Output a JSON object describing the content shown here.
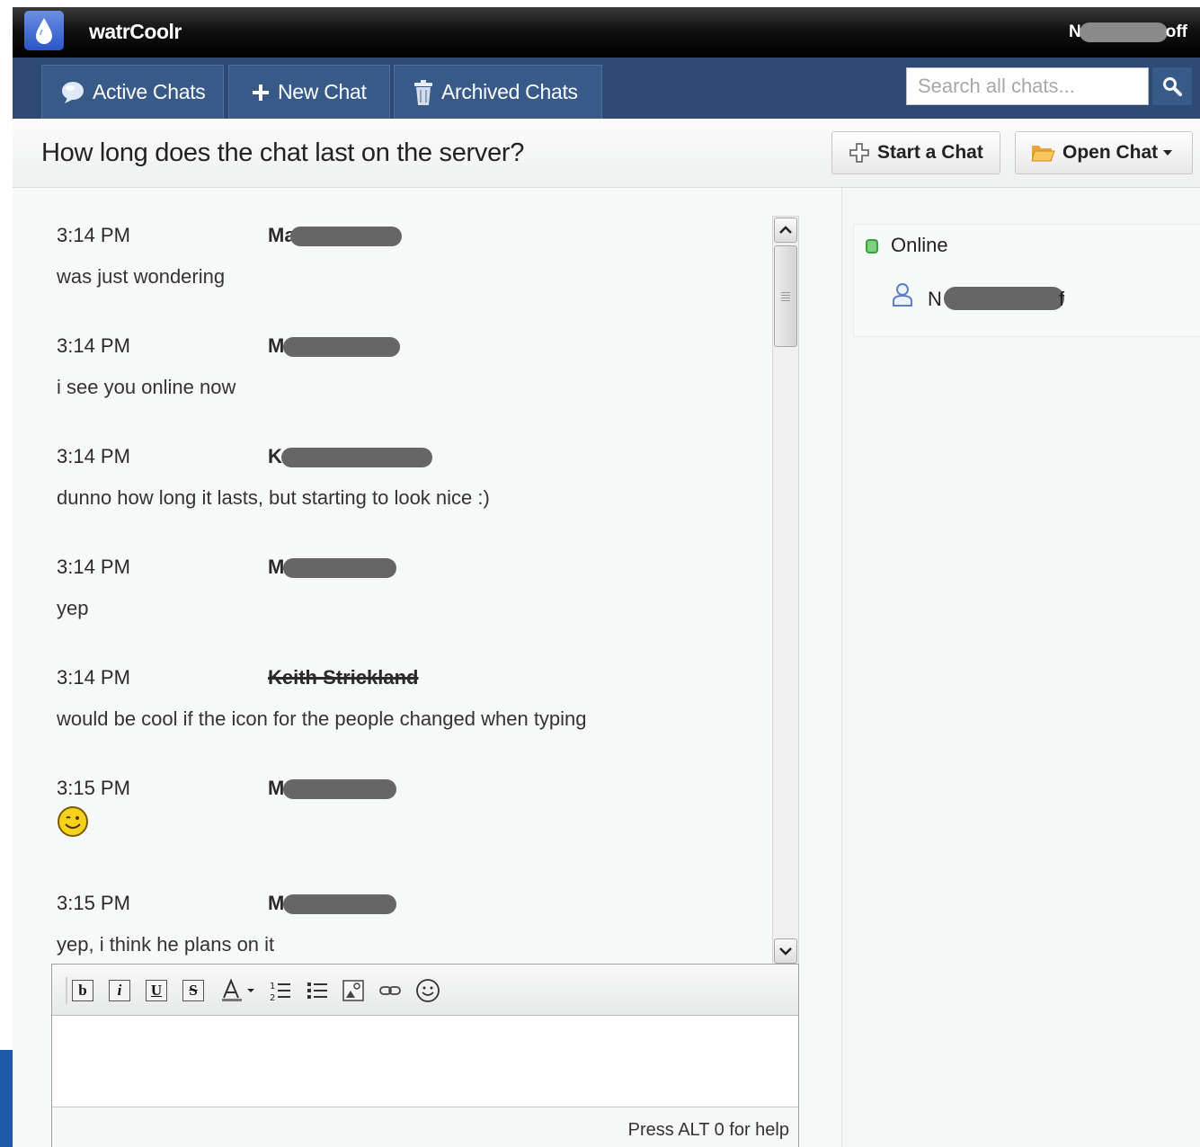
{
  "app": {
    "title": "watrCoolr",
    "user_display": {
      "prefix": "N",
      "suffix": "off"
    }
  },
  "nav": {
    "tabs": [
      {
        "label": "Active Chats",
        "icon": "chat-bubble-icon"
      },
      {
        "label": "New Chat",
        "icon": "plus-icon"
      },
      {
        "label": "Archived Chats",
        "icon": "trash-icon"
      }
    ],
    "search": {
      "placeholder": "Search all chats...",
      "value": ""
    }
  },
  "chat": {
    "title": "How long does the chat last on the server?",
    "actions": {
      "start": "Start a Chat",
      "open": "Open Chat"
    }
  },
  "messages": [
    {
      "time": "3:14 PM",
      "author_visible": "Ma",
      "text": "was just wondering"
    },
    {
      "time": "3:14 PM",
      "author_visible": "M",
      "text": "i see you online now"
    },
    {
      "time": "3:14 PM",
      "author_visible": "K",
      "text": "dunno how long it lasts, but starting to look nice :)"
    },
    {
      "time": "3:14 PM",
      "author_visible": "M",
      "text": "yep"
    },
    {
      "time": "3:14 PM",
      "author_visible": "Keith Strickland",
      "text": "would be cool if the icon for the people changed when typing"
    },
    {
      "time": "3:15 PM",
      "author_visible": "M",
      "text": "",
      "emoji": "wink-smiley-icon"
    },
    {
      "time": "3:15 PM",
      "author_visible": "M",
      "text": "yep, i think he plans on it"
    }
  ],
  "editor": {
    "toolbar": [
      "b",
      "i",
      "U",
      "S"
    ],
    "help": "Press ALT 0 for help"
  },
  "presence": {
    "heading": "Online",
    "users": [
      {
        "visible_prefix": "N",
        "visible_suffix": "f"
      }
    ]
  },
  "colors": {
    "topbar": "#000000",
    "navbar": "#2c4a74",
    "tab": "#375a88",
    "accent_online": "#3aa03a"
  }
}
